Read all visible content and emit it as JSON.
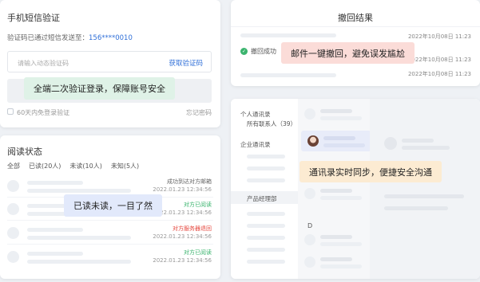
{
  "sms_card": {
    "title": "手机短信验证",
    "sent_prefix": "验证码已通过短信发送至：",
    "phone": "156****0010",
    "code_placeholder": "请输入动态验证码",
    "get_code_link": "获取验证码",
    "remember_label": "60天内免登录验证",
    "forgot_link": "忘记密码"
  },
  "read_card": {
    "title": "阅读状态",
    "tabs": [
      "全部",
      "已读(20人)",
      "未读(10人)",
      "未知(5人)"
    ],
    "rows": [
      {
        "status": "成功到达对方邮箱",
        "time": "2022.01.23 12:34:56",
        "color": "#666666"
      },
      {
        "status": "对方已阅读",
        "time": "2022.01.23 12:34:56",
        "color": "#3bb46e"
      },
      {
        "status": "对方服务器退回",
        "time": "2022.01.23 12:34:56",
        "color": "#e5483f"
      },
      {
        "status": "对方已阅读",
        "time": "2022.01.23 12:34:56",
        "color": "#3bb46e"
      }
    ]
  },
  "recall_card": {
    "title": "撤回结果",
    "date": "2022年10月08日 11:23",
    "success_label": "撤回成功"
  },
  "contacts_card": {
    "personal": "个人通讯录",
    "all_contacts": "所有联系人（39）",
    "enterprise": "企业通讯录",
    "dept": "产品经理部",
    "index_letter": "D"
  },
  "callouts": {
    "login": "全端二次验证登录，保障账号安全",
    "recall": "邮件一键撤回，避免误发尴尬",
    "read": "已读未读，一目了然",
    "contacts": "通讯录实时同步，便捷安全沟通"
  }
}
